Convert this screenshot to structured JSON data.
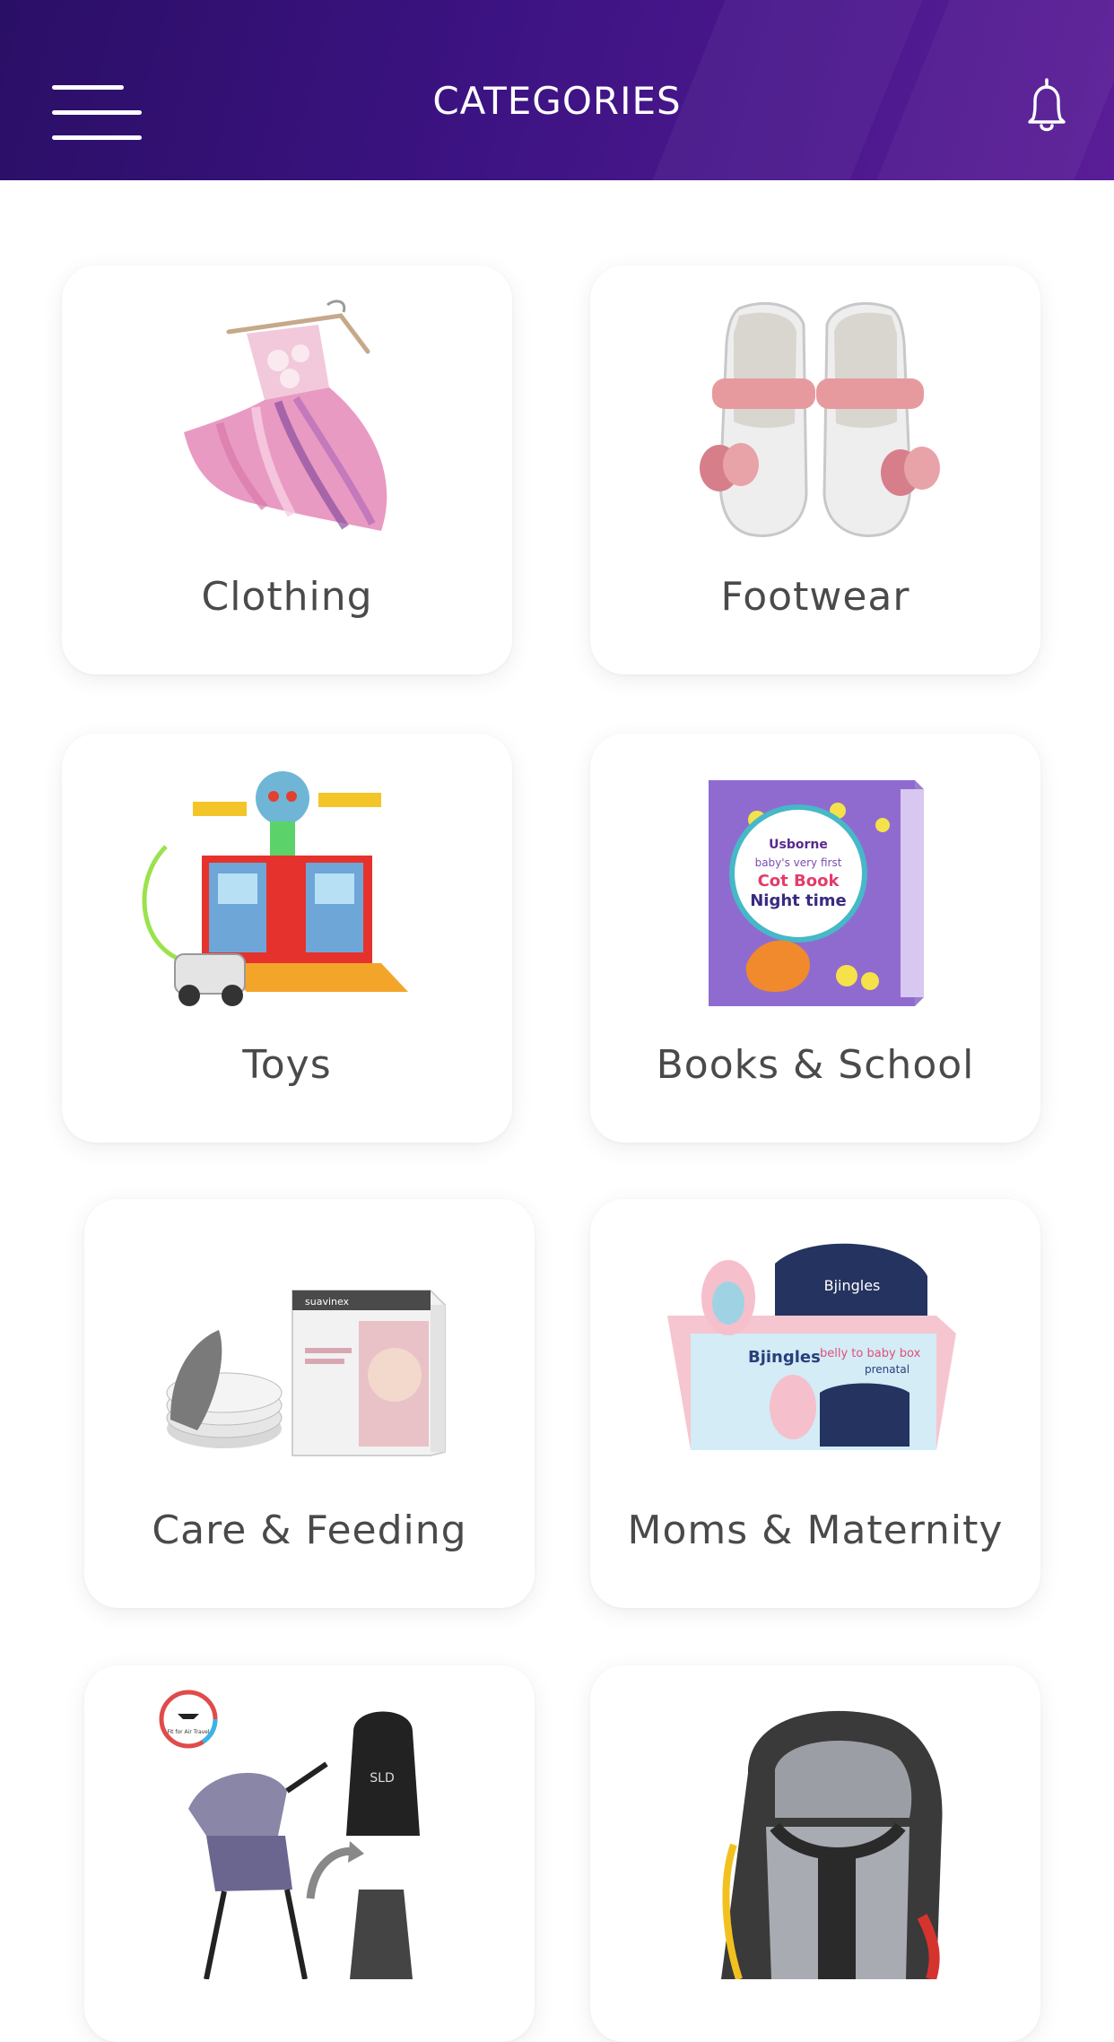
{
  "header": {
    "title": "CATEGORIES",
    "menu_icon": "hamburger-menu-icon",
    "notification_icon": "bell-icon",
    "gradient_start": "#2a0f66",
    "gradient_end": "#5a1d97"
  },
  "categories": [
    {
      "label": "Clothing",
      "image": "pink-tutu-dress-image"
    },
    {
      "label": "Footwear",
      "image": "baby-shoes-image"
    },
    {
      "label": "Toys",
      "image": "toy-playset-image"
    },
    {
      "label": "Books & School",
      "image": "board-book-box-image"
    },
    {
      "label": "Care & Feeding",
      "image": "breast-pads-box-image"
    },
    {
      "label": "Moms & Maternity",
      "image": "maternity-gift-box-image"
    },
    {
      "label": "",
      "image": "stroller-image",
      "overlay_texts": [
        "SLD",
        "Fit for Air Travel"
      ]
    },
    {
      "label": "",
      "image": "car-seat-image"
    }
  ],
  "product_texts": {
    "book_brand": "Usborne",
    "book_title_line1": "baby's very first",
    "book_title_line2": "Cot Book",
    "book_title_line3": "Night time",
    "pads_brand": "suavinex",
    "maternity_brand": "Bjingles",
    "maternity_tagline": "belly to baby box",
    "maternity_sub": "prenatal"
  },
  "colors": {
    "label_text": "#4a4a4a",
    "card_background": "#ffffff",
    "page_background": "#ffffff"
  }
}
